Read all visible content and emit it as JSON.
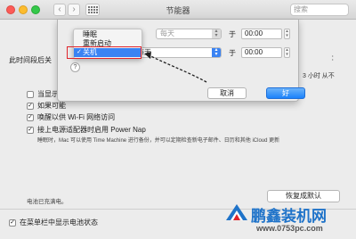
{
  "window": {
    "title": "节能器",
    "search_placeholder": "搜索",
    "nav_back": "‹",
    "nav_fwd": "›"
  },
  "panel": {
    "left_label_prefix": "此时间段后关",
    "right_stub_line1": "3 小时 从不",
    "right_stub_line2": "：",
    "checkboxes": [
      {
        "label": "当显示器",
        "checked": false
      },
      {
        "label": "如果可能",
        "checked": true
      },
      {
        "label": "唤醒以供 Wi-Fi 网络访问",
        "checked": true
      },
      {
        "label": "接上电源适配器时启用 Power Nap",
        "checked": true
      }
    ],
    "power_nap_desc": "睡眠时，Mac 可以使用 Time Machine 进行备份，并可以定期检查新电子邮件、日历和其他 iCloud 更新",
    "battery_note": "电池已充满电。",
    "restore_button": "恢复成默认",
    "menu_bar_battery": {
      "label": "在菜单栏中显示电池状态",
      "checked": true
    }
  },
  "sheet": {
    "row1": {
      "schedule": "每天",
      "yu": "于",
      "time": "00:00"
    },
    "row2": {
      "schedule": "每天",
      "yu": "于",
      "time": "00:00"
    },
    "help": "?",
    "cancel_button": "取消",
    "ok_button": "好"
  },
  "popup_menu": {
    "items": [
      {
        "label": "睡眠",
        "checked": false,
        "selected": false
      },
      {
        "label": "重新启动",
        "checked": false,
        "selected": false
      },
      {
        "label": "关机",
        "checked": true,
        "selected": true
      }
    ]
  },
  "watermark": {
    "text": "鹏鑫装机网",
    "url": "www.0753pc.com"
  },
  "colors": {
    "accent": "#3a83f3",
    "highlight_box": "#e0242b",
    "watermark": "#1f73c9"
  }
}
